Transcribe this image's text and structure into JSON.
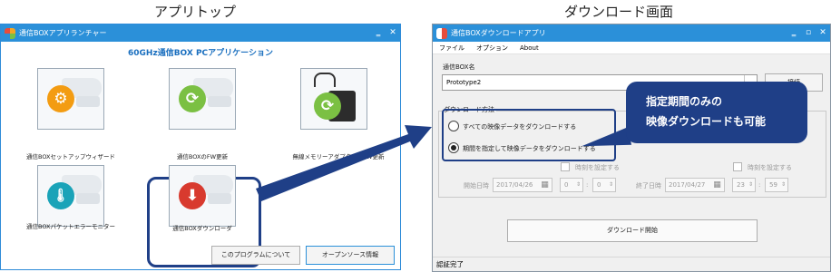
{
  "headings": {
    "left": "アプリトップ",
    "right": "ダウンロード画面"
  },
  "left_window": {
    "title": "通信BOXアプリランチャー",
    "heading": "60GHz通信BOX PCアプリケーション",
    "tiles": [
      {
        "label": "通信BOXセットアップウィザード",
        "icon": "gear-icon",
        "color": "#f39c12"
      },
      {
        "label": "通信BOXのFW更新",
        "icon": "refresh-icon",
        "color": "#7bc043"
      },
      {
        "label": "無線メモリーアダプターのFW更新",
        "icon": "refresh-icon",
        "color": "#7bc043"
      },
      {
        "label": "通信BOXパケットエラーモニター",
        "icon": "thermometer-icon",
        "color": "#1aa3b8"
      },
      {
        "label": "通信BOXダウンローダ",
        "icon": "download-icon",
        "color": "#d83a2e"
      }
    ],
    "buttons": {
      "about": "このプログラムについて",
      "oss": "オープンソース情報"
    },
    "window_controls": {
      "minimize": "‗",
      "close": "✕"
    }
  },
  "right_window": {
    "title": "通信BOXダウンロードアプリ",
    "menu": [
      "ファイル",
      "オプション",
      "About"
    ],
    "box_name_label": "通信BOX名",
    "box_name_value": "Prototype2",
    "connect_button": "接続",
    "method_label": "ダウンロード方法",
    "options": [
      {
        "label": "すべての映像データをダウンロードする",
        "selected": false
      },
      {
        "label": "期間を指定して映像データをダウンロードする",
        "selected": true
      }
    ],
    "time_setting_label": "時刻を設定する",
    "start_label": "開始日時",
    "start_date": "2017/04/26",
    "start_hour": "0",
    "start_min": "0",
    "end_label": "終了日時",
    "end_date": "2017/04/27",
    "end_hour": "23",
    "end_min": "59",
    "start_button": "ダウンロード開始",
    "status": "認証完了",
    "window_controls": {
      "minimize": "‗",
      "maximize": "▫",
      "close": "✕"
    }
  },
  "callout": {
    "line1": "指定期間のみの",
    "line2": "映像ダウンロードも可能"
  },
  "colors": {
    "accent": "#2b90d9",
    "highlight": "#1f3f87",
    "heading": "#1a6fbf"
  }
}
